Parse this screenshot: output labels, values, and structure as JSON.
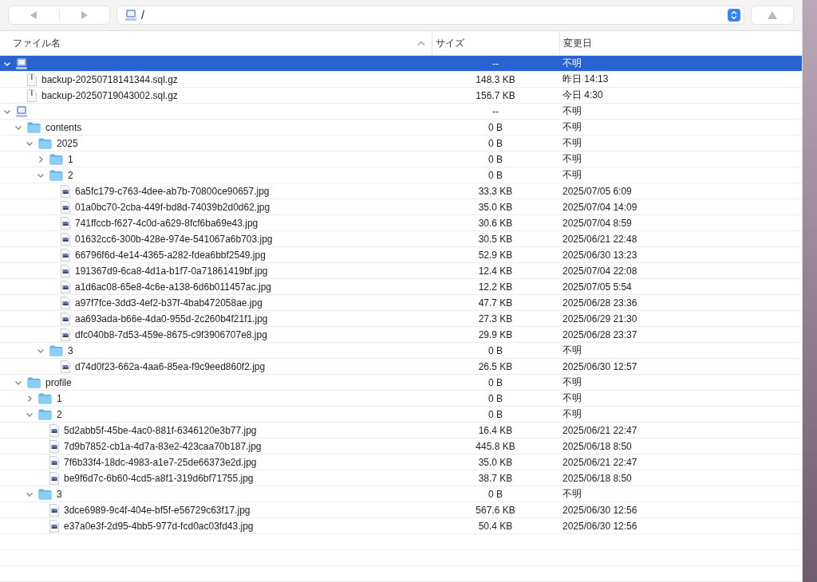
{
  "toolbar": {
    "path": "/"
  },
  "columns": [
    {
      "label": "ファイル名",
      "sorted": true
    },
    {
      "label": "サイズ",
      "sorted": false
    },
    {
      "label": "変更日",
      "sorted": false
    }
  ],
  "tree": [
    {
      "kind": "drive",
      "size": "--",
      "modified": "不明",
      "expanded": true,
      "selected": true,
      "children": [
        {
          "kind": "archive",
          "name": "backup-20250718141344.sql.gz",
          "size": "148.3 KB",
          "modified": "昨日 14:13",
          "selected": false
        },
        {
          "kind": "archive",
          "name": "backup-20250719043002.sql.gz",
          "size": "156.7 KB",
          "modified": "今日 4:30",
          "selected": false
        }
      ]
    },
    {
      "kind": "drive",
      "size": "--",
      "modified": "不明",
      "expanded": true,
      "selected": false,
      "children": [
        {
          "kind": "folder",
          "name": "contents",
          "size": "0 B",
          "modified": "不明",
          "expanded": true,
          "selected": false,
          "children": [
            {
              "kind": "folder",
              "name": "2025",
              "size": "0 B",
              "modified": "不明",
              "expanded": true,
              "selected": false,
              "children": [
                {
                  "kind": "folder",
                  "name": "1",
                  "size": "0 B",
                  "modified": "不明",
                  "expanded": false,
                  "selected": false
                },
                {
                  "kind": "folder",
                  "name": "2",
                  "size": "0 B",
                  "modified": "不明",
                  "expanded": true,
                  "selected": false,
                  "children": [
                    {
                      "kind": "image",
                      "name": "6a5fc179-c763-4dee-ab7b-70800ce90657.jpg",
                      "size": "33.3 KB",
                      "modified": "2025/07/05 6:09",
                      "selected": false
                    },
                    {
                      "kind": "image",
                      "name": "01a0bc70-2cba-449f-bd8d-74039b2d0d62.jpg",
                      "size": "35.0 KB",
                      "modified": "2025/07/04 14:09",
                      "selected": false
                    },
                    {
                      "kind": "image",
                      "name": "741ffccb-f627-4c0d-a629-8fcf6ba69e43.jpg",
                      "size": "30.6 KB",
                      "modified": "2025/07/04 8:59",
                      "selected": false
                    },
                    {
                      "kind": "image",
                      "name": "01632cc6-300b-428e-974e-541067a6b703.jpg",
                      "size": "30.5 KB",
                      "modified": "2025/06/21 22:48",
                      "selected": false
                    },
                    {
                      "kind": "image",
                      "name": "66796f6d-4e14-4365-a282-fdea6bbf2549.jpg",
                      "size": "52.9 KB",
                      "modified": "2025/06/30 13:23",
                      "selected": false
                    },
                    {
                      "kind": "image",
                      "name": "191367d9-6ca8-4d1a-b1f7-0a71861419bf.jpg",
                      "size": "12.4 KB",
                      "modified": "2025/07/04 22:08",
                      "selected": false
                    },
                    {
                      "kind": "image",
                      "name": "a1d6ac08-65e8-4c6e-a138-6d6b011457ac.jpg",
                      "size": "12.2 KB",
                      "modified": "2025/07/05 5:54",
                      "selected": false
                    },
                    {
                      "kind": "image",
                      "name": "a97f7fce-3dd3-4ef2-b37f-4bab472058ae.jpg",
                      "size": "47.7 KB",
                      "modified": "2025/06/28 23:36",
                      "selected": false
                    },
                    {
                      "kind": "image",
                      "name": "aa693ada-b66e-4da0-955d-2c260b4f21f1.jpg",
                      "size": "27.3 KB",
                      "modified": "2025/06/29 21:30",
                      "selected": false
                    },
                    {
                      "kind": "image",
                      "name": "dfc040b8-7d53-459e-8675-c9f3906707e8.jpg",
                      "size": "29.9 KB",
                      "modified": "2025/06/28 23:37",
                      "selected": false
                    }
                  ]
                },
                {
                  "kind": "folder",
                  "name": "3",
                  "size": "0 B",
                  "modified": "不明",
                  "expanded": true,
                  "selected": false,
                  "children": [
                    {
                      "kind": "image",
                      "name": "d74d0f23-662a-4aa6-85ea-f9c9eed860f2.jpg",
                      "size": "26.5 KB",
                      "modified": "2025/06/30 12:57",
                      "selected": false
                    }
                  ]
                }
              ]
            }
          ]
        },
        {
          "kind": "folder",
          "name": "profile",
          "size": "0 B",
          "modified": "不明",
          "expanded": true,
          "selected": false,
          "children": [
            {
              "kind": "folder",
              "name": "1",
              "size": "0 B",
              "modified": "不明",
              "expanded": false,
              "selected": false
            },
            {
              "kind": "folder",
              "name": "2",
              "size": "0 B",
              "modified": "不明",
              "expanded": true,
              "selected": false,
              "children": [
                {
                  "kind": "image",
                  "name": "5d2abb5f-45be-4ac0-881f-6346120e3b77.jpg",
                  "size": "16.4 KB",
                  "modified": "2025/06/21 22:47",
                  "selected": false
                },
                {
                  "kind": "image",
                  "name": "7d9b7852-cb1a-4d7a-83e2-423caa70b187.jpg",
                  "size": "445.8 KB",
                  "modified": "2025/06/18 8:50",
                  "selected": false
                },
                {
                  "kind": "image",
                  "name": "7f6b33f4-18dc-4983-a1e7-25de66373e2d.jpg",
                  "size": "35.0 KB",
                  "modified": "2025/06/21 22:47",
                  "selected": false
                },
                {
                  "kind": "image",
                  "name": "be9f6d7c-6b60-4cd5-a8f1-319d6bf71755.jpg",
                  "size": "38.7 KB",
                  "modified": "2025/06/18 8:50",
                  "selected": false
                }
              ]
            },
            {
              "kind": "folder",
              "name": "3",
              "size": "0 B",
              "modified": "不明",
              "expanded": true,
              "selected": false,
              "children": [
                {
                  "kind": "image",
                  "name": "3dce6989-9c4f-404e-bf5f-e56729c63f17.jpg",
                  "size": "567.6 KB",
                  "modified": "2025/06/30 12:56",
                  "selected": false
                },
                {
                  "kind": "image",
                  "name": "e37a0e3f-2d95-4bb5-977d-fcd0ac03fd43.jpg",
                  "size": "50.4 KB",
                  "modified": "2025/06/30 12:56",
                  "selected": false
                }
              ]
            }
          ]
        }
      ]
    }
  ]
}
